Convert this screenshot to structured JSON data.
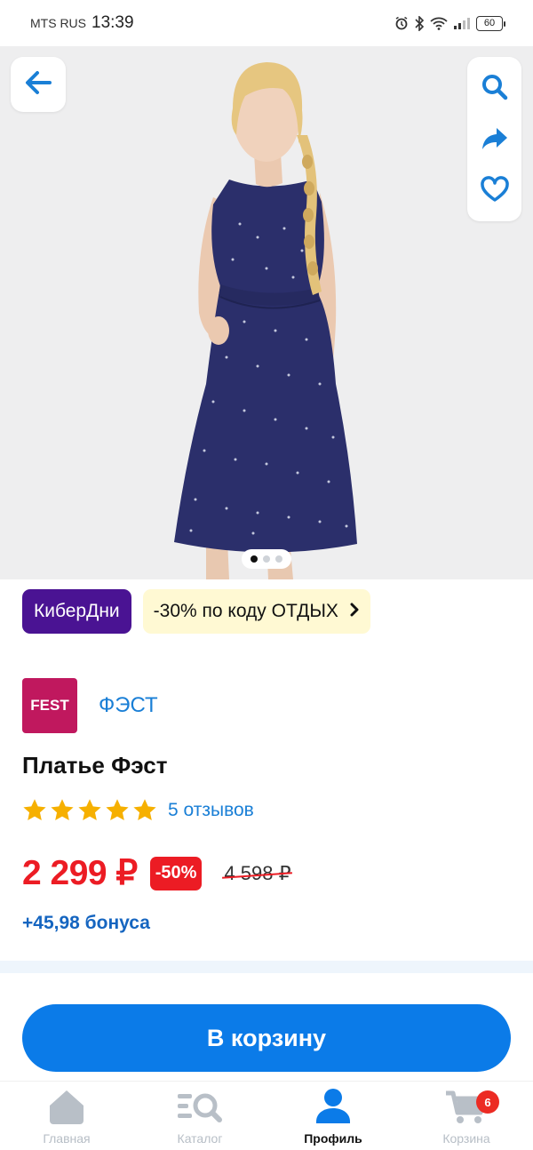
{
  "status_bar": {
    "carrier": "MTS RUS",
    "time": "13:39",
    "battery": "60"
  },
  "product_image": {
    "alt": "Платье Фэст",
    "carousel_count": 3,
    "carousel_active": 1,
    "colors": {
      "background": "#eeeeef",
      "dress": "#2b2f6b"
    }
  },
  "actions": {
    "back_icon": "arrow-left-icon",
    "search_icon": "search-icon",
    "share_icon": "share-icon",
    "favorite_icon": "heart-icon"
  },
  "promo": {
    "tag": "КиберДни",
    "code_text": "-30% по коду ОТДЫХ"
  },
  "brand": {
    "logo_text": "FEST",
    "name": "ФЭСТ"
  },
  "product": {
    "title": "Платье Фэст",
    "rating": 5,
    "reviews": "5 отзывов",
    "price": "2 299 ₽",
    "discount": "-50%",
    "old_price": "4 598 ₽",
    "bonus": "+45,98 бонуса"
  },
  "cart_button": {
    "label": "В корзину"
  },
  "bottom_nav": {
    "items": [
      {
        "label": "Главная",
        "icon": "home-icon"
      },
      {
        "label": "Каталог",
        "icon": "catalog-icon"
      },
      {
        "label": "Профиль",
        "icon": "profile-icon"
      },
      {
        "label": "Корзина",
        "icon": "cart-icon"
      }
    ],
    "active_index": 2,
    "cart_badge": "6"
  },
  "colors": {
    "accent_blue": "#0b7be8",
    "price_red": "#ec1c24",
    "promo_purple": "#4a1393",
    "promo_yellow": "#fff9d3",
    "brand_magenta": "#c0185e"
  }
}
